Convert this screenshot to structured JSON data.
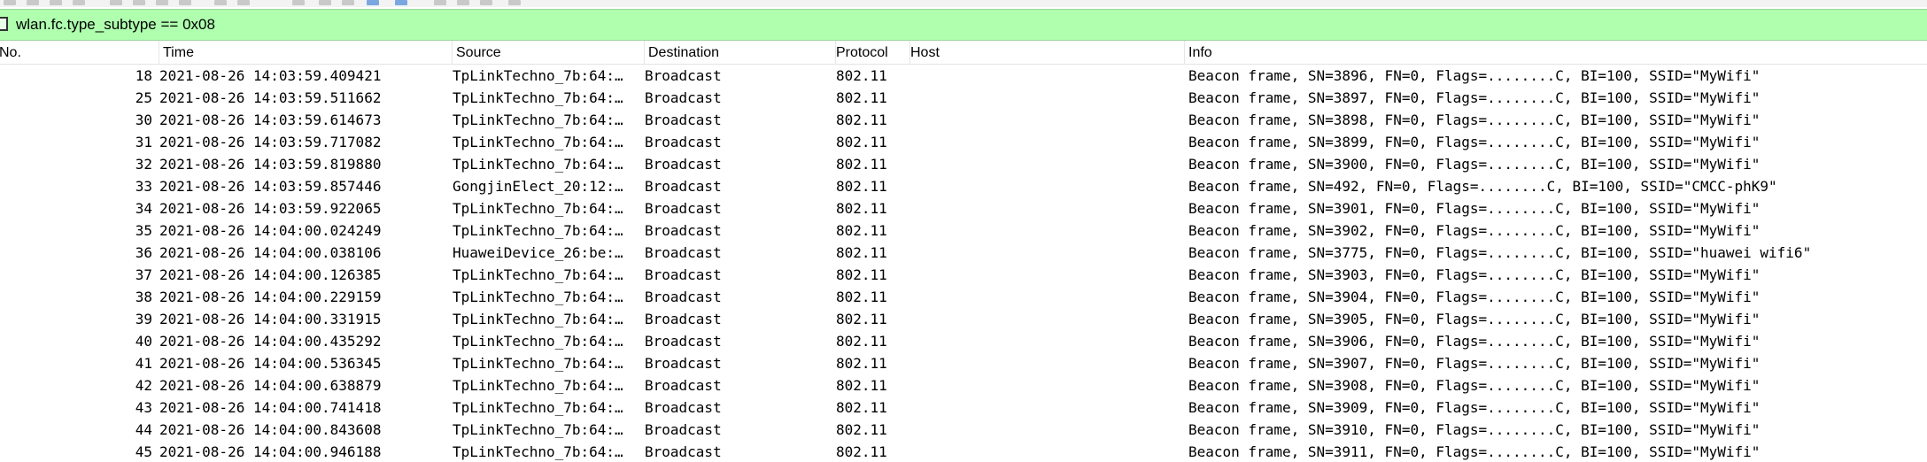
{
  "filter": {
    "value": "wlan.fc.type_subtype == 0x08"
  },
  "columns": {
    "no": "No.",
    "time": "Time",
    "source": "Source",
    "destination": "Destination",
    "protocol": "Protocol",
    "host": "Host",
    "info": "Info"
  },
  "rows": [
    {
      "no": "18",
      "time": "2021-08-26 14:03:59.409421",
      "source": "TpLinkTechno_7b:64:…",
      "destination": "Broadcast",
      "protocol": "802.11",
      "host": "",
      "info": "Beacon frame, SN=3896, FN=0, Flags=........C, BI=100, SSID=\"MyWifi\""
    },
    {
      "no": "25",
      "time": "2021-08-26 14:03:59.511662",
      "source": "TpLinkTechno_7b:64:…",
      "destination": "Broadcast",
      "protocol": "802.11",
      "host": "",
      "info": "Beacon frame, SN=3897, FN=0, Flags=........C, BI=100, SSID=\"MyWifi\""
    },
    {
      "no": "30",
      "time": "2021-08-26 14:03:59.614673",
      "source": "TpLinkTechno_7b:64:…",
      "destination": "Broadcast",
      "protocol": "802.11",
      "host": "",
      "info": "Beacon frame, SN=3898, FN=0, Flags=........C, BI=100, SSID=\"MyWifi\""
    },
    {
      "no": "31",
      "time": "2021-08-26 14:03:59.717082",
      "source": "TpLinkTechno_7b:64:…",
      "destination": "Broadcast",
      "protocol": "802.11",
      "host": "",
      "info": "Beacon frame, SN=3899, FN=0, Flags=........C, BI=100, SSID=\"MyWifi\""
    },
    {
      "no": "32",
      "time": "2021-08-26 14:03:59.819880",
      "source": "TpLinkTechno_7b:64:…",
      "destination": "Broadcast",
      "protocol": "802.11",
      "host": "",
      "info": "Beacon frame, SN=3900, FN=0, Flags=........C, BI=100, SSID=\"MyWifi\""
    },
    {
      "no": "33",
      "time": "2021-08-26 14:03:59.857446",
      "source": "GongjinElect_20:12:…",
      "destination": "Broadcast",
      "protocol": "802.11",
      "host": "",
      "info": "Beacon frame, SN=492, FN=0, Flags=........C, BI=100, SSID=\"CMCC-phK9\""
    },
    {
      "no": "34",
      "time": "2021-08-26 14:03:59.922065",
      "source": "TpLinkTechno_7b:64:…",
      "destination": "Broadcast",
      "protocol": "802.11",
      "host": "",
      "info": "Beacon frame, SN=3901, FN=0, Flags=........C, BI=100, SSID=\"MyWifi\""
    },
    {
      "no": "35",
      "time": "2021-08-26 14:04:00.024249",
      "source": "TpLinkTechno_7b:64:…",
      "destination": "Broadcast",
      "protocol": "802.11",
      "host": "",
      "info": "Beacon frame, SN=3902, FN=0, Flags=........C, BI=100, SSID=\"MyWifi\""
    },
    {
      "no": "36",
      "time": "2021-08-26 14:04:00.038106",
      "source": "HuaweiDevice_26:be:…",
      "destination": "Broadcast",
      "protocol": "802.11",
      "host": "",
      "info": "Beacon frame, SN=3775, FN=0, Flags=........C, BI=100, SSID=\"huawei wifi6\""
    },
    {
      "no": "37",
      "time": "2021-08-26 14:04:00.126385",
      "source": "TpLinkTechno_7b:64:…",
      "destination": "Broadcast",
      "protocol": "802.11",
      "host": "",
      "info": "Beacon frame, SN=3903, FN=0, Flags=........C, BI=100, SSID=\"MyWifi\""
    },
    {
      "no": "38",
      "time": "2021-08-26 14:04:00.229159",
      "source": "TpLinkTechno_7b:64:…",
      "destination": "Broadcast",
      "protocol": "802.11",
      "host": "",
      "info": "Beacon frame, SN=3904, FN=0, Flags=........C, BI=100, SSID=\"MyWifi\""
    },
    {
      "no": "39",
      "time": "2021-08-26 14:04:00.331915",
      "source": "TpLinkTechno_7b:64:…",
      "destination": "Broadcast",
      "protocol": "802.11",
      "host": "",
      "info": "Beacon frame, SN=3905, FN=0, Flags=........C, BI=100, SSID=\"MyWifi\""
    },
    {
      "no": "40",
      "time": "2021-08-26 14:04:00.435292",
      "source": "TpLinkTechno_7b:64:…",
      "destination": "Broadcast",
      "protocol": "802.11",
      "host": "",
      "info": "Beacon frame, SN=3906, FN=0, Flags=........C, BI=100, SSID=\"MyWifi\""
    },
    {
      "no": "41",
      "time": "2021-08-26 14:04:00.536345",
      "source": "TpLinkTechno_7b:64:…",
      "destination": "Broadcast",
      "protocol": "802.11",
      "host": "",
      "info": "Beacon frame, SN=3907, FN=0, Flags=........C, BI=100, SSID=\"MyWifi\""
    },
    {
      "no": "42",
      "time": "2021-08-26 14:04:00.638879",
      "source": "TpLinkTechno_7b:64:…",
      "destination": "Broadcast",
      "protocol": "802.11",
      "host": "",
      "info": "Beacon frame, SN=3908, FN=0, Flags=........C, BI=100, SSID=\"MyWifi\""
    },
    {
      "no": "43",
      "time": "2021-08-26 14:04:00.741418",
      "source": "TpLinkTechno_7b:64:…",
      "destination": "Broadcast",
      "protocol": "802.11",
      "host": "",
      "info": "Beacon frame, SN=3909, FN=0, Flags=........C, BI=100, SSID=\"MyWifi\""
    },
    {
      "no": "44",
      "time": "2021-08-26 14:04:00.843608",
      "source": "TpLinkTechno_7b:64:…",
      "destination": "Broadcast",
      "protocol": "802.11",
      "host": "",
      "info": "Beacon frame, SN=3910, FN=0, Flags=........C, BI=100, SSID=\"MyWifi\""
    },
    {
      "no": "45",
      "time": "2021-08-26 14:04:00.946188",
      "source": "TpLinkTechno_7b:64:…",
      "destination": "Broadcast",
      "protocol": "802.11",
      "host": "",
      "info": "Beacon frame, SN=3911, FN=0, Flags=........C, BI=100, SSID=\"MyWifi\""
    }
  ]
}
